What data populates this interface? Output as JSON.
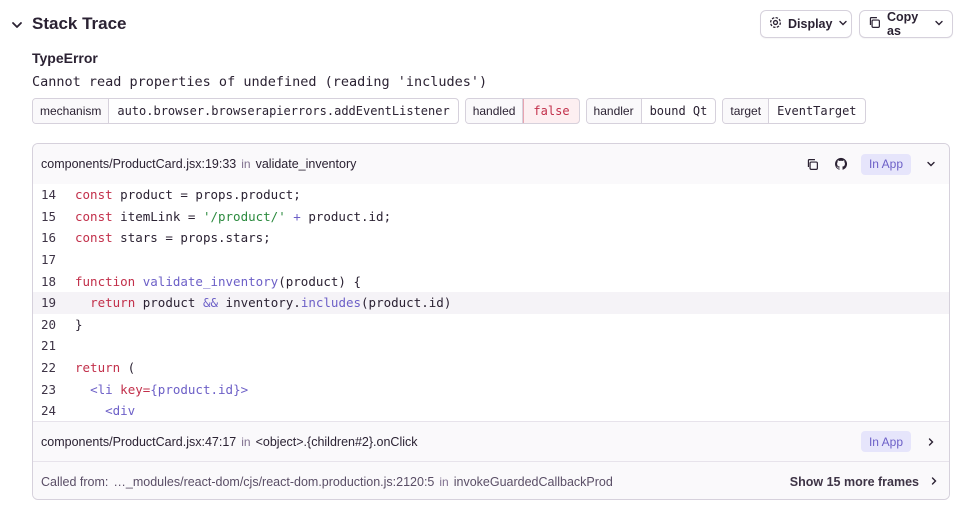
{
  "header": {
    "title": "Stack Trace",
    "display_label": "Display",
    "copy_label": "Copy as"
  },
  "exception": {
    "type": "TypeError",
    "value": "Cannot read properties of undefined (reading 'includes')"
  },
  "tags": [
    {
      "key": "mechanism",
      "value": "auto.browser.browserapierrors.addEventListener"
    },
    {
      "key": "handled",
      "value": "false"
    },
    {
      "key": "handler",
      "value": "bound Qt"
    },
    {
      "key": "target",
      "value": "EventTarget"
    }
  ],
  "frames": {
    "in_word": "in",
    "frame1": {
      "path": "components/ProductCard.jsx:19:33",
      "function": "validate_inventory",
      "badge": "In App"
    },
    "frame2": {
      "path": "components/ProductCard.jsx:47:17",
      "function": "<object>.{children#2}.onClick",
      "badge": "In App"
    },
    "called_from": {
      "prefix": "Called from:",
      "path": "…_modules/react-dom/cjs/react-dom.production.js:2120:5",
      "function": "invokeGuardedCallbackProd",
      "show_more": "Show 15 more frames"
    }
  },
  "code_lines": [
    {
      "n": "14"
    },
    {
      "n": "15"
    },
    {
      "n": "16"
    },
    {
      "n": "17"
    },
    {
      "n": "18"
    },
    {
      "n": "19"
    },
    {
      "n": "20"
    },
    {
      "n": "21"
    },
    {
      "n": "22"
    },
    {
      "n": "23"
    },
    {
      "n": "24"
    }
  ],
  "code_tokens": {
    "l14": {
      "kw": "const",
      "rest": " product = props.product;"
    },
    "l15": {
      "kw": "const",
      "a": " itemLink = ",
      "str": "'/product/'",
      "op": " + ",
      "b": "product.id;"
    },
    "l16": {
      "kw": "const",
      "rest": " stars = props.stars;"
    },
    "l18": {
      "kw": "function",
      "fn": " validate_inventory",
      "rest": "(product) {"
    },
    "l19": {
      "kw": "return",
      "a": " product ",
      "op": "&&",
      "b": " inventory.",
      "fn": "includes",
      "c": "(product.id)"
    },
    "l20": {
      "rest": "}"
    },
    "l22": {
      "kw": "return",
      "rest": " ("
    },
    "l23": {
      "tag": "<li",
      "attr": " key=",
      "val": "{product.id}",
      "close": ">"
    },
    "l24": {
      "tag": "<div"
    }
  },
  "colors": {
    "accent": "#6c5fc7",
    "keyword": "#c22f4a",
    "string": "#2b8a3e",
    "danger": "#c22f4a"
  }
}
